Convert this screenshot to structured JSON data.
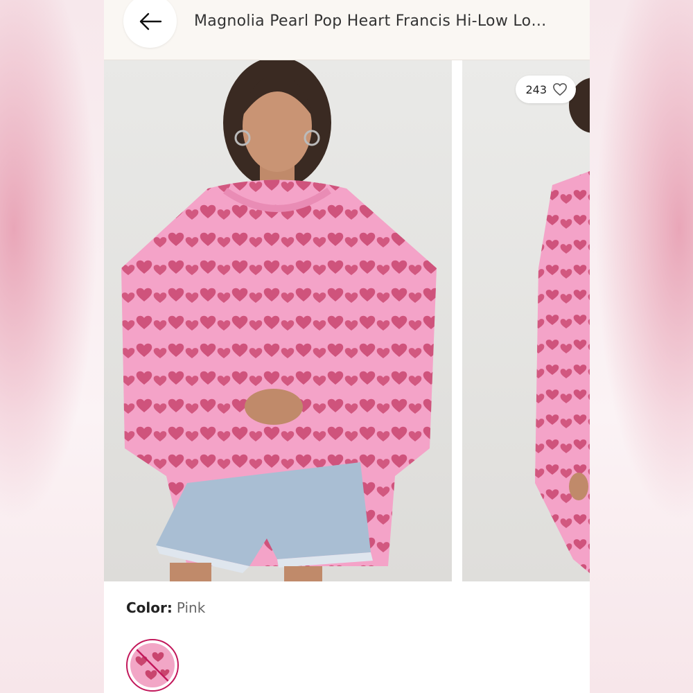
{
  "header": {
    "back_icon": "arrow-left-icon",
    "title": "Magnolia Pearl Pop Heart Francis Hi-Low Lo…"
  },
  "gallery": {
    "likes_count": "243",
    "likes_icon": "heart-outline-icon"
  },
  "color": {
    "label": "Color:",
    "value": "Pink",
    "swatch_state": "unavailable",
    "swatch_color": "#f2a6c6"
  },
  "colors": {
    "shirt": "#f4a3c8",
    "heart": "#c9456e",
    "shorts": "#a9bed3",
    "skin": "#c08a6a",
    "hair": "#3a2a22"
  }
}
